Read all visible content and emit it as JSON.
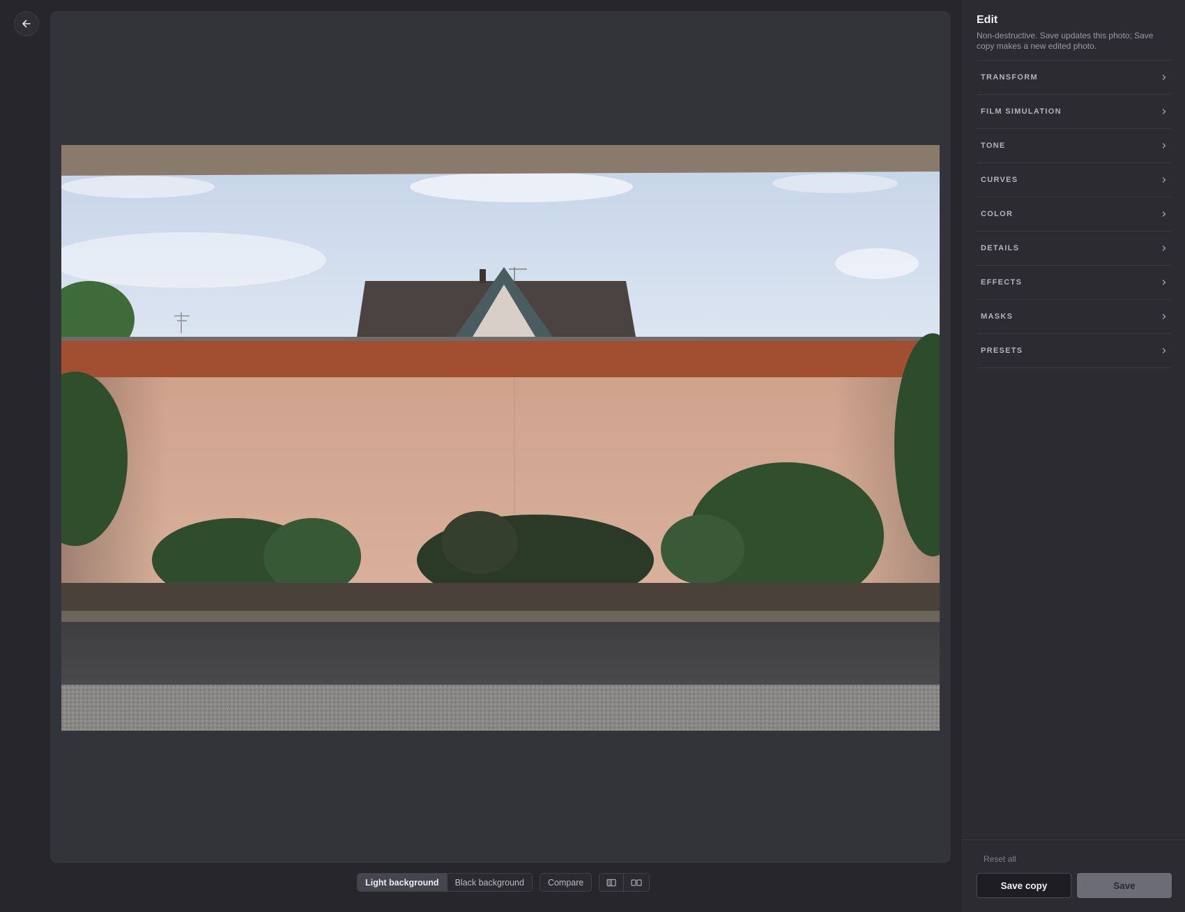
{
  "nav": {
    "back_icon": "arrow-left-icon"
  },
  "photo": {
    "alt": "House roof behind a salmon-pink wall with shrubs and a gravel road"
  },
  "toolbar": {
    "background_options": [
      "Light background",
      "Black background"
    ],
    "active_background": "Light background",
    "compare_label": "Compare",
    "view_icons": [
      "split-view-icon",
      "side-by-side-icon"
    ]
  },
  "panel": {
    "title": "Edit",
    "subtitle": "Non-destructive. Save updates this photo; Save copy makes a new edited photo.",
    "sections": [
      {
        "label": "TRANSFORM"
      },
      {
        "label": "FILM SIMULATION"
      },
      {
        "label": "TONE"
      },
      {
        "label": "CURVES"
      },
      {
        "label": "COLOR"
      },
      {
        "label": "DETAILS"
      },
      {
        "label": "EFFECTS"
      },
      {
        "label": "MASKS"
      },
      {
        "label": "PRESETS"
      }
    ],
    "section_icon": "chevron-right-icon",
    "reset_label": "Reset all",
    "save_copy_label": "Save copy",
    "save_label": "Save"
  },
  "colors": {
    "background": "#26262b",
    "canvas": "#33333a",
    "panel": "#2b2b31",
    "save_disabled": "#6c6c74"
  }
}
